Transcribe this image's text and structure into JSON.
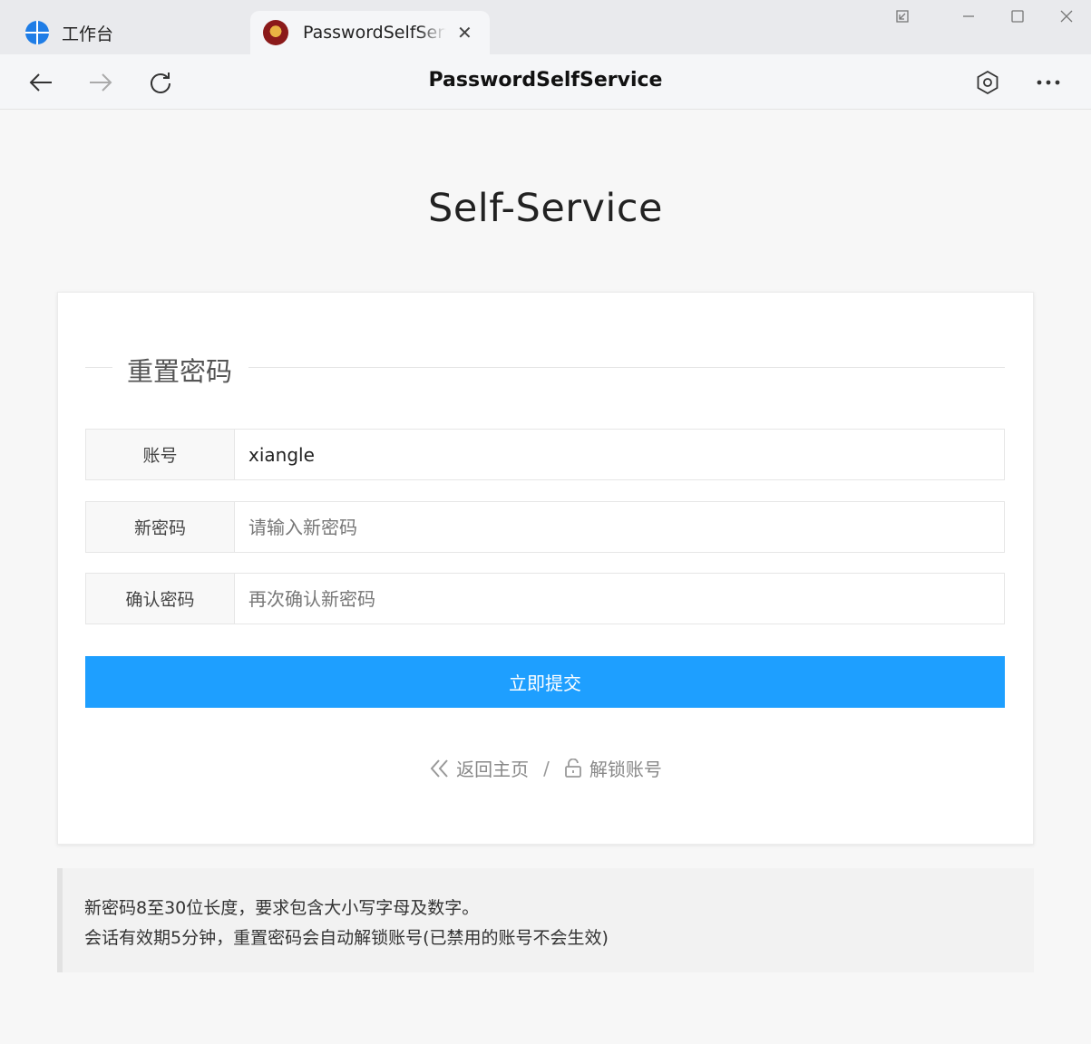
{
  "tabs": [
    {
      "title": "工作台",
      "icon": "workspace-grid-icon"
    },
    {
      "title": "PasswordSelfService",
      "icon": "avatar-icon"
    }
  ],
  "toolbar": {
    "page_title": "PasswordSelfService"
  },
  "page": {
    "heading": "Self-Service",
    "section_title": "重置密码",
    "fields": [
      {
        "label": "账号",
        "value": "xiangle",
        "placeholder": ""
      },
      {
        "label": "新密码",
        "value": "",
        "placeholder": "请输入新密码"
      },
      {
        "label": "确认密码",
        "value": "",
        "placeholder": "再次确认新密码"
      }
    ],
    "submit_label": "立即提交",
    "links": {
      "home": "返回主页",
      "separator": "/",
      "unlock": "解锁账号"
    },
    "notes": [
      "新密码8至30位长度，要求包含大小写字母及数字。",
      "会话有效期5分钟，重置密码会自动解锁账号(已禁用的账号不会生效)"
    ]
  },
  "colors": {
    "accent": "#1e9fff",
    "tabbar_bg": "#e9eaed",
    "page_bg": "#f7f7f7"
  }
}
